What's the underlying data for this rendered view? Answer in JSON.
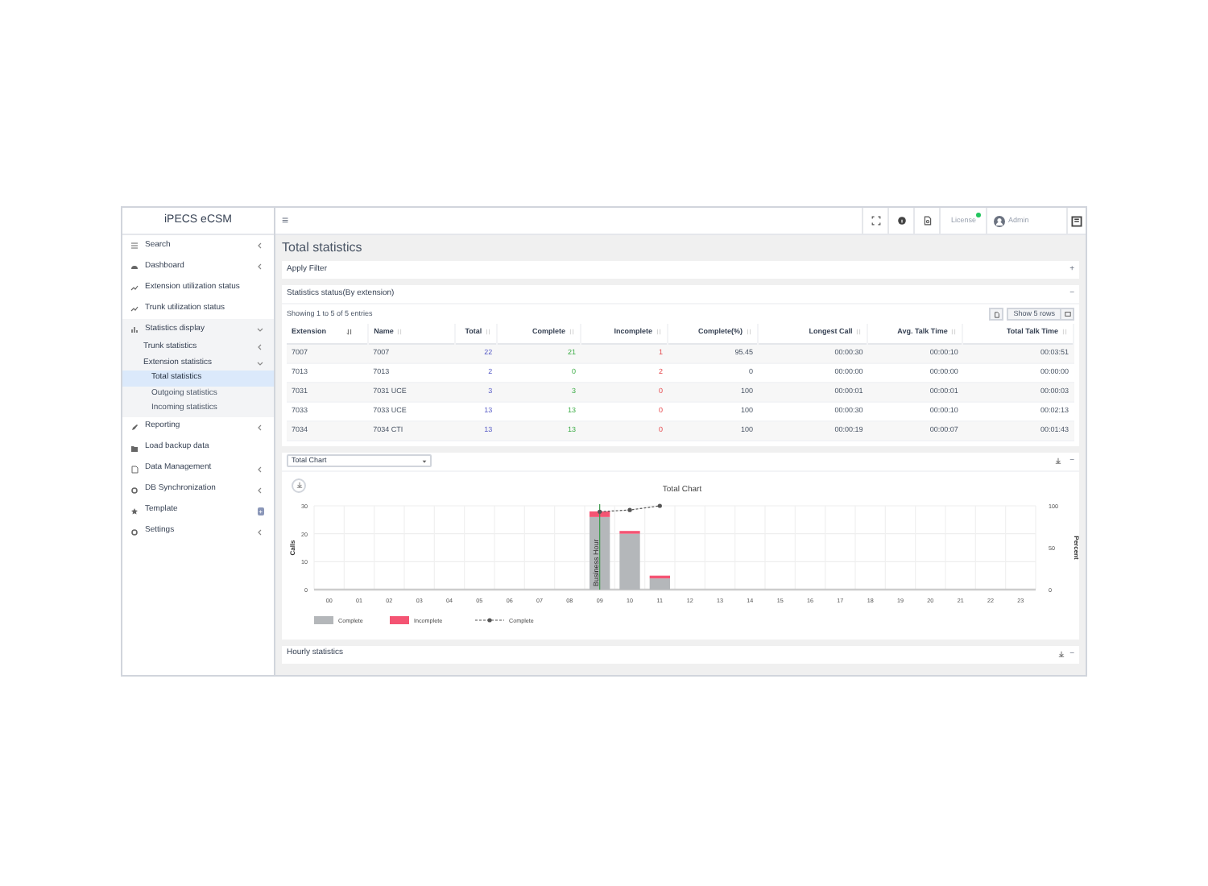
{
  "sidebar": {
    "title": "iPECS eCSM",
    "items": [
      {
        "label": "Search",
        "expanded": false
      },
      {
        "label": "Dashboard",
        "expanded": false
      },
      {
        "label": "Extension utilization status"
      },
      {
        "label": "Trunk utilization status"
      },
      {
        "label": "Statistics display",
        "expanded": true,
        "children": [
          {
            "label": "Trunk statistics",
            "expanded": false
          },
          {
            "label": "Extension statistics",
            "expanded": true,
            "children": [
              {
                "label": "Total statistics",
                "selected": true
              },
              {
                "label": "Outgoing statistics",
                "selected": false
              },
              {
                "label": "Incoming statistics",
                "selected": false
              }
            ]
          }
        ]
      },
      {
        "label": "Reporting",
        "expanded": false
      },
      {
        "label": "Load backup data"
      },
      {
        "label": "Data Management",
        "expanded": false
      },
      {
        "label": "DB Synchronization",
        "expanded": false
      },
      {
        "label": "Template",
        "badge": "+"
      },
      {
        "label": "Settings",
        "expanded": false
      }
    ]
  },
  "header": {
    "menu": "≡",
    "license": "License",
    "license_online": true,
    "user": "Admin"
  },
  "page_title": "Total statistics",
  "filter_panel": {
    "title": "Apply Filter",
    "toggle": "+"
  },
  "stats_panel": {
    "title": "Statistics status(By extension)",
    "toggle": "−",
    "info": "Showing 1 to 5 of 5 entries",
    "rows_button": "Show 5 rows",
    "columns": [
      {
        "label": "Extension",
        "sorted": true
      },
      {
        "label": "Name",
        "sorted": false
      },
      {
        "label": "Total",
        "sorted": false
      },
      {
        "label": "Complete",
        "sorted": false
      },
      {
        "label": "Incomplete",
        "sorted": false
      },
      {
        "label": "Complete(%)",
        "sorted": false
      },
      {
        "label": "Longest Call",
        "sorted": false
      },
      {
        "label": "Avg. Talk Time",
        "sorted": false
      },
      {
        "label": "Total Talk Time",
        "sorted": false
      }
    ],
    "rows": [
      [
        "7007",
        "7007",
        "22",
        "21",
        "1",
        "95.45",
        "00:00:30",
        "00:00:10",
        "00:03:51"
      ],
      [
        "7013",
        "7013",
        "2",
        "0",
        "2",
        "0",
        "00:00:00",
        "00:00:00",
        "00:00:00"
      ],
      [
        "7031",
        "7031 UCE",
        "3",
        "3",
        "0",
        "100",
        "00:00:01",
        "00:00:01",
        "00:00:03"
      ],
      [
        "7033",
        "7033 UCE",
        "13",
        "13",
        "0",
        "100",
        "00:00:30",
        "00:00:10",
        "00:02:13"
      ],
      [
        "7034",
        "7034 CTI",
        "13",
        "13",
        "0",
        "100",
        "00:00:19",
        "00:00:07",
        "00:01:43"
      ]
    ]
  },
  "chart_panel": {
    "select": "Total Chart",
    "toggle": "−",
    "chart_data": {
      "type": "bar",
      "title": "Total Chart",
      "ylabel": "Calls",
      "stacked": true,
      "categories": [
        "00",
        "01",
        "02",
        "03",
        "04",
        "05",
        "06",
        "07",
        "08",
        "09",
        "10",
        "11",
        "12",
        "13",
        "14",
        "15",
        "16",
        "17",
        "18",
        "19",
        "20",
        "21",
        "22",
        "23"
      ],
      "ylim": [
        0,
        30
      ],
      "yticks": [
        0,
        10,
        20,
        30
      ],
      "series": [
        {
          "name": "Complete",
          "color": "#b4b7ba",
          "values": [
            0,
            0,
            0,
            0,
            0,
            0,
            0,
            0,
            0,
            26,
            20,
            4,
            0,
            0,
            0,
            0,
            0,
            0,
            0,
            0,
            0,
            0,
            0,
            0
          ]
        },
        {
          "name": "Incomplete",
          "color": "#f45473",
          "values": [
            0,
            0,
            0,
            0,
            0,
            0,
            0,
            0,
            0,
            2,
            1,
            1,
            0,
            0,
            0,
            0,
            0,
            0,
            0,
            0,
            0,
            0,
            0,
            0
          ]
        }
      ],
      "legend": "bottom",
      "annotations": [
        {
          "x": "09",
          "text": "Business Hour"
        }
      ]
    },
    "percent_chart": {
      "chart_data": {
        "type": "line",
        "ylabel": "Percent",
        "categories": [
          null,
          null,
          null,
          null,
          null,
          null,
          null,
          null,
          null,
          null,
          null,
          null,
          null,
          null,
          null,
          null,
          null,
          null,
          null,
          null,
          null,
          null,
          null,
          null
        ],
        "ylim": [
          0,
          100
        ],
        "yticks": [
          0,
          50,
          100
        ],
        "series": [
          {
            "name": "Complete",
            "color": "#555555",
            "line_style": "dashed",
            "values": [
              null,
              null,
              null,
              null,
              null,
              null,
              null,
              null,
              null,
              93,
              95,
              100,
              null,
              null,
              null,
              null,
              null,
              null,
              null,
              null,
              null,
              null,
              null,
              null
            ]
          }
        ],
        "legend": "bottom"
      }
    }
  },
  "hourly_panel": {
    "title": "Hourly statistics",
    "toggle": "−"
  }
}
